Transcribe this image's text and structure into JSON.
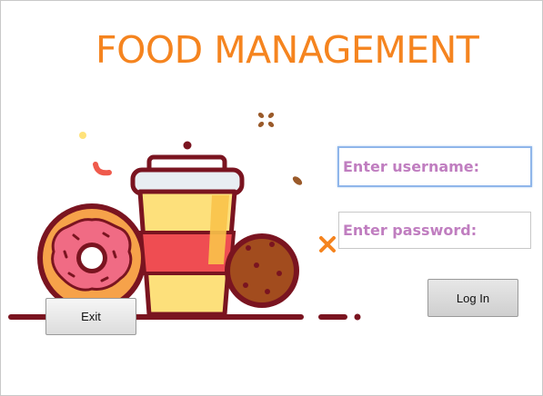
{
  "app": {
    "title": "FOOD MANAGEMENT"
  },
  "form": {
    "username_placeholder": "Enter username:",
    "password_placeholder": "Enter password:",
    "login_label": "Log In",
    "exit_label": "Exit"
  },
  "colors": {
    "title": "#f5841f",
    "field_text": "#c07ec0",
    "focus_border": "#8fb6ea"
  },
  "illustration": {
    "items": [
      "donut-icon",
      "coffee-cup-icon",
      "cookie-icon",
      "sprinkle-decorations"
    ]
  }
}
